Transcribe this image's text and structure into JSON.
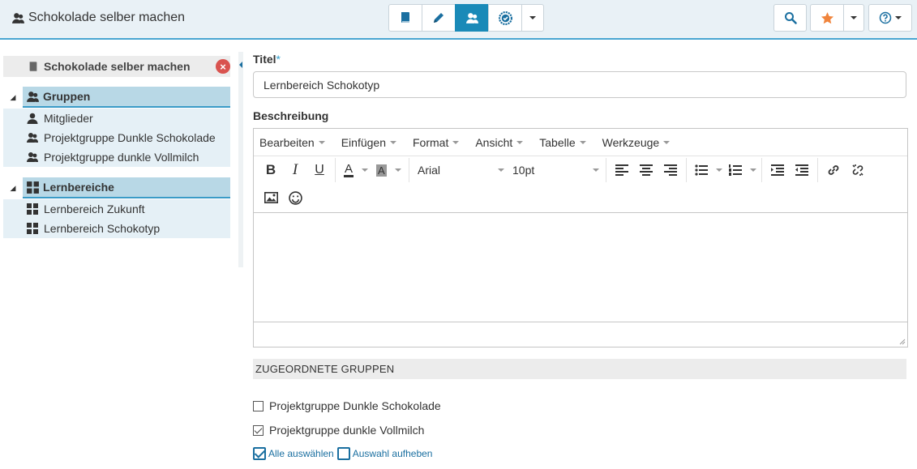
{
  "header": {
    "title": "Schokolade selber machen",
    "toolbar": [
      {
        "icon": "book-icon"
      },
      {
        "icon": "pencil-icon"
      },
      {
        "icon": "group-icon",
        "active": true
      },
      {
        "icon": "badge-icon"
      },
      {
        "icon": "chevron-down-icon"
      }
    ],
    "right": [
      {
        "icon": "search-icon"
      },
      {
        "icon": "star-icon",
        "color": "#f0843c"
      },
      {
        "icon": "help-icon"
      }
    ]
  },
  "sidebar": {
    "course": {
      "label": "Schokolade selber machen"
    },
    "close_symbol": "×",
    "toggle_symbol": "◢",
    "sections": [
      {
        "label": "Gruppen",
        "items": [
          {
            "label": "Mitglieder",
            "icon": "user-icon"
          },
          {
            "label": "Projektgruppe Dunkle Schokolade",
            "icon": "group-icon"
          },
          {
            "label": "Projektgruppe dunkle Vollmilch",
            "icon": "group-icon"
          }
        ]
      },
      {
        "label": "Lernbereiche",
        "items": [
          {
            "label": "Lernbereich Zukunft",
            "icon": "grid-icon"
          },
          {
            "label": "Lernbereich Schokotyp",
            "icon": "grid-icon"
          }
        ]
      }
    ]
  },
  "form": {
    "title_label": "Titel",
    "required_mark": "*",
    "title_value": "Lernbereich Schokotyp",
    "description_label": "Beschreibung",
    "editor": {
      "menus": [
        "Bearbeiten",
        "Einfügen",
        "Format",
        "Ansicht",
        "Tabelle",
        "Werkzeuge"
      ],
      "font_family": "Arial",
      "font_size": "10pt",
      "bold": "B",
      "italic": "I",
      "underline": "U",
      "text_color": "A",
      "bg_color": "A"
    },
    "assigned_groups_header": "ZUGEORDNETE GRUPPEN",
    "groups": [
      {
        "label": "Projektgruppe Dunkle Schokolade",
        "checked": false
      },
      {
        "label": "Projektgruppe dunkle Vollmilch",
        "checked": true
      }
    ],
    "select_all": "Alle auswählen",
    "deselect": "Auswahl aufheben"
  }
}
